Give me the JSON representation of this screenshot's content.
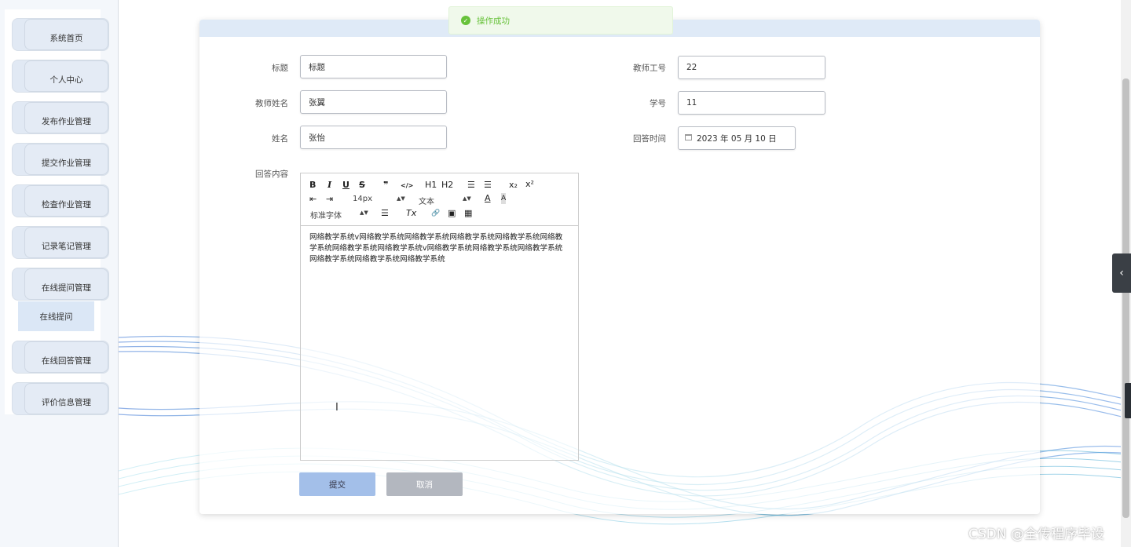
{
  "sidebar": {
    "items": [
      {
        "label": "系统首页"
      },
      {
        "label": "个人中心"
      },
      {
        "label": "发布作业管理"
      },
      {
        "label": "提交作业管理"
      },
      {
        "label": "检查作业管理"
      },
      {
        "label": "记录笔记管理"
      },
      {
        "label": "在线提问管理"
      },
      {
        "label": "在线回答管理"
      },
      {
        "label": "评价信息管理"
      }
    ],
    "submenu": {
      "label": "在线提问"
    }
  },
  "toast": {
    "message": "操作成功",
    "icon": "check-circle-icon"
  },
  "form": {
    "title_label": "标题",
    "title_value": "标题",
    "teacher_no_label": "教师工号",
    "teacher_no_value": "22",
    "teacher_name_label": "教师姓名",
    "teacher_name_value": "张翼",
    "student_no_label": "学号",
    "student_no_value": "11",
    "name_label": "姓名",
    "name_value": "张怡",
    "answer_time_label": "回答时间",
    "answer_time_value": "2023 年 05 月 10 日",
    "content_label": "回答内容",
    "content_value": "网络教学系统v网络教学系统网络教学系统网络教学系统网络教学系统网络教学系统网络教学系统网络教学系统v网络教学系统网络教学系统网络教学系统网络教学系统网络教学系统网络教学系统"
  },
  "editor_toolbar": {
    "bold": "B",
    "italic": "I",
    "underline": "U",
    "strike": "S",
    "blockquote": "❞",
    "code": "</>",
    "h1": "H1",
    "h2": "H2",
    "ordered_list": "☰",
    "bullet_list": "☰",
    "subscript": "x₂",
    "superscript": "x²",
    "outdent": "⇤",
    "indent": "⇥",
    "font_size": "14px",
    "text_style": "文本",
    "font_color": "A",
    "bg_color": "A",
    "font_family": "标准字体",
    "align": "☰",
    "clean": "Tx",
    "link": "🔗",
    "image": "▣",
    "video": "▦"
  },
  "buttons": {
    "submit": "提交",
    "cancel": "取消"
  },
  "watermark": "CSDN @全传程序毕设",
  "colors": {
    "accent": "#a3bfe9",
    "success": "#67c23a",
    "sidebar_bg": "#e4ebf5"
  }
}
